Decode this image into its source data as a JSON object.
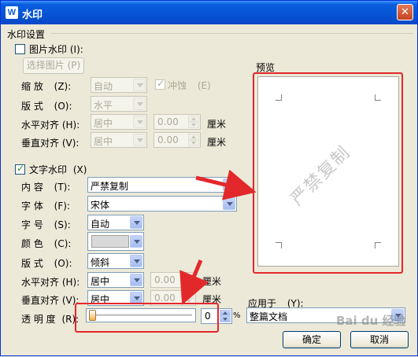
{
  "window": {
    "title": "水印",
    "app_icon": "W",
    "close_glyph": "✕"
  },
  "section_title": "水印设置",
  "picture_watermark": {
    "checkbox_label": "图片水印",
    "checkbox_hotkey": "(I):",
    "checked": false,
    "select_button": "选择图片",
    "select_hotkey": "(P)",
    "zoom_label": "缩  放",
    "zoom_hotkey": "(Z):",
    "zoom_value": "自动",
    "washout_label": "冲蚀",
    "washout_hotkey": "(E)",
    "layout_label": "版  式",
    "layout_hotkey": "(O):",
    "layout_value": "水平",
    "halign_label": "水平对齐",
    "halign_hotkey": "(H):",
    "halign_value": "居中",
    "halign_offset": "0.00",
    "valign_label": "垂直对齐",
    "valign_hotkey": "(V):",
    "valign_value": "居中",
    "valign_offset": "0.00",
    "unit": "厘米"
  },
  "text_watermark": {
    "checkbox_label": "文字水印",
    "checkbox_hotkey": "(X)",
    "checked": true,
    "content_label": "内  容",
    "content_hotkey": "(T):",
    "content_value": "严禁复制",
    "font_label": "字  体",
    "font_hotkey": "(F):",
    "font_value": "宋体",
    "size_label": "字  号",
    "size_hotkey": "(S):",
    "size_value": "自动",
    "color_label": "颜  色",
    "color_hotkey": "(C):",
    "color_value": "#d9d9d9",
    "layout_label": "版  式",
    "layout_hotkey": "(O):",
    "layout_value": "倾斜",
    "halign_label": "水平对齐",
    "halign_hotkey": "(H):",
    "halign_value": "居中",
    "halign_offset": "0.00",
    "valign_label": "垂直对齐",
    "valign_hotkey": "(V):",
    "valign_value": "居中",
    "valign_offset": "0.00",
    "unit": "厘米",
    "transparency_label": "透 明 度",
    "transparency_hotkey": "(R):",
    "transparency_value": "0",
    "transparency_fraction": 0,
    "percent": "%"
  },
  "preview": {
    "label": "预览",
    "watermark_text": "严禁复制"
  },
  "apply_to": {
    "label": "应用于",
    "hotkey": "(Y):",
    "value": "整篇文档"
  },
  "buttons": {
    "ok": "确定",
    "cancel": "取消"
  },
  "site_watermark": "Bai du 经验",
  "colors": {
    "title_bar": "#0553d4",
    "highlight": "#e3282c",
    "dialog_bg": "#ece9d8"
  },
  "icons": {
    "arrow_annotation": "red-arrow-icon",
    "check": "checkmark-icon"
  }
}
